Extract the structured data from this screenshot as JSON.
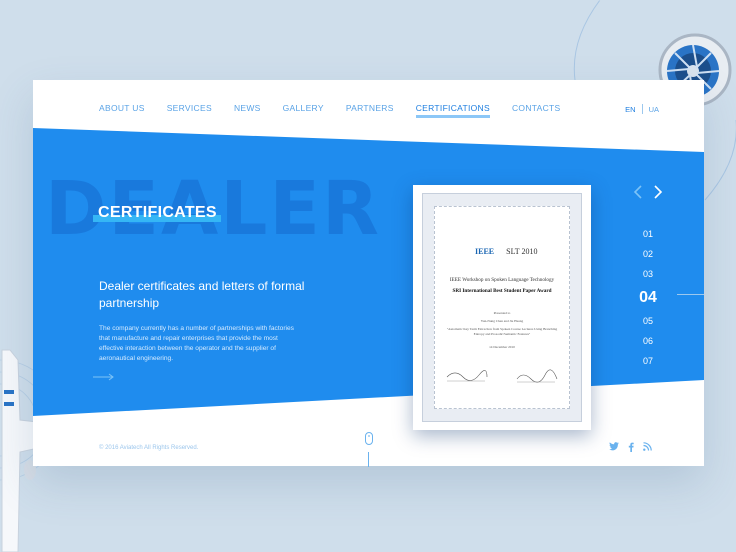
{
  "nav": {
    "items": [
      "ABOUT US",
      "SERVICES",
      "NEWS",
      "GALLERY",
      "PARTNERS",
      "CERTIFICATIONS",
      "CONTACTS"
    ],
    "active": "CERTIFICATIONS"
  },
  "lang": {
    "en": "EN",
    "ua": "UA"
  },
  "hero": {
    "background_word": "DEALER",
    "title": "CERTIFICATES",
    "subtitle": "Dealer certificates and letters of formal partnership",
    "description": "The company currently has a number of partnerships with factories that manufacture and repair enterprises that provide the most effective interaction between the operator and the supplier of aeronautical engineering."
  },
  "certificate": {
    "logo": "IEEE",
    "year": "SLT 2010",
    "line1": "IEEE Workshop on Spoken Language Technology",
    "line2": "SRI International Best Student Paper Award",
    "presented": "Presented to",
    "names": "Yun-Nung Chen    and Jie Huang",
    "paper": "\"Automatic Key Term Extraction from Spoken Course Lectures Using Branching Entropy and Prosodic/Semantic Features\"",
    "date": "14 December 2010"
  },
  "pager": {
    "items": [
      "01",
      "02",
      "03",
      "04",
      "05",
      "06",
      "07"
    ],
    "active": "04"
  },
  "footer": {
    "copyright": "© 2016 Aviatech All Rights Reserved."
  },
  "colors": {
    "primary": "#1f8cee",
    "accent": "#35b6f5",
    "background": "#cfdeeb"
  },
  "icons": {
    "prev": "chevron-left-icon",
    "next": "chevron-right-icon",
    "scroll": "mouse-icon",
    "twitter": "twitter-icon",
    "facebook": "facebook-icon",
    "rss": "rss-icon"
  }
}
